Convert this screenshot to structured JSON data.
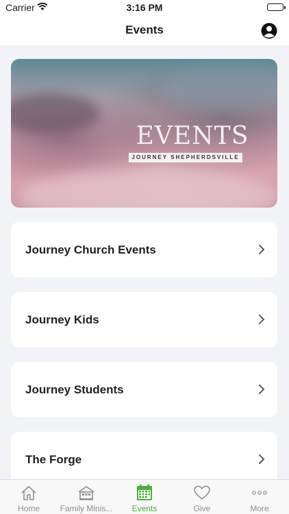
{
  "status": {
    "carrier": "Carrier",
    "time": "3:16 PM"
  },
  "nav": {
    "title": "Events"
  },
  "hero": {
    "title": "EVENTS",
    "subtitle": "JOURNEY SHEPHERDSVILLE"
  },
  "cards": [
    {
      "label": "Journey Church Events"
    },
    {
      "label": "Journey Kids"
    },
    {
      "label": "Journey Students"
    },
    {
      "label": "The Forge"
    }
  ],
  "tabs": [
    {
      "label": "Home",
      "icon": "home-icon"
    },
    {
      "label": "Family Minis...",
      "icon": "building-icon"
    },
    {
      "label": "Events",
      "icon": "calendar-icon"
    },
    {
      "label": "Give",
      "icon": "heart-icon"
    },
    {
      "label": "More",
      "icon": "more-icon"
    }
  ],
  "colors": {
    "accent": "#4caf3a",
    "inactive": "#8e8e93"
  }
}
